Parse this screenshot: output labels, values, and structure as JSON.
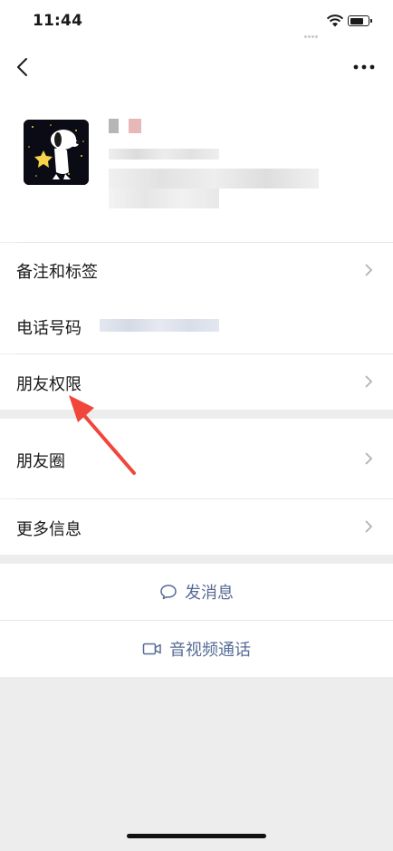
{
  "status_bar": {
    "time": "11:44",
    "icons": [
      "signal-dots-icon",
      "wifi-icon",
      "battery-icon"
    ]
  },
  "nav": {
    "back_icon": "chevron-left-icon",
    "more_icon": "ellipsis-icon"
  },
  "profile": {
    "avatar_icon": "snoopy-avatar-icon"
  },
  "rows": [
    {
      "label": "备注和标签",
      "has_chevron": true
    },
    {
      "label": "电话号码",
      "has_chevron": false
    },
    {
      "label": "朋友权限",
      "has_chevron": true
    },
    {
      "label": "朋友圈",
      "has_chevron": true
    },
    {
      "label": "更多信息",
      "has_chevron": true
    }
  ],
  "actions": {
    "message": {
      "label": "发消息",
      "icon": "chat-bubble-icon"
    },
    "call": {
      "label": "音视频通话",
      "icon": "video-camera-icon"
    }
  },
  "colors": {
    "background": "#ededed",
    "link": "#576b95",
    "annotation_arrow": "#f0463c"
  }
}
